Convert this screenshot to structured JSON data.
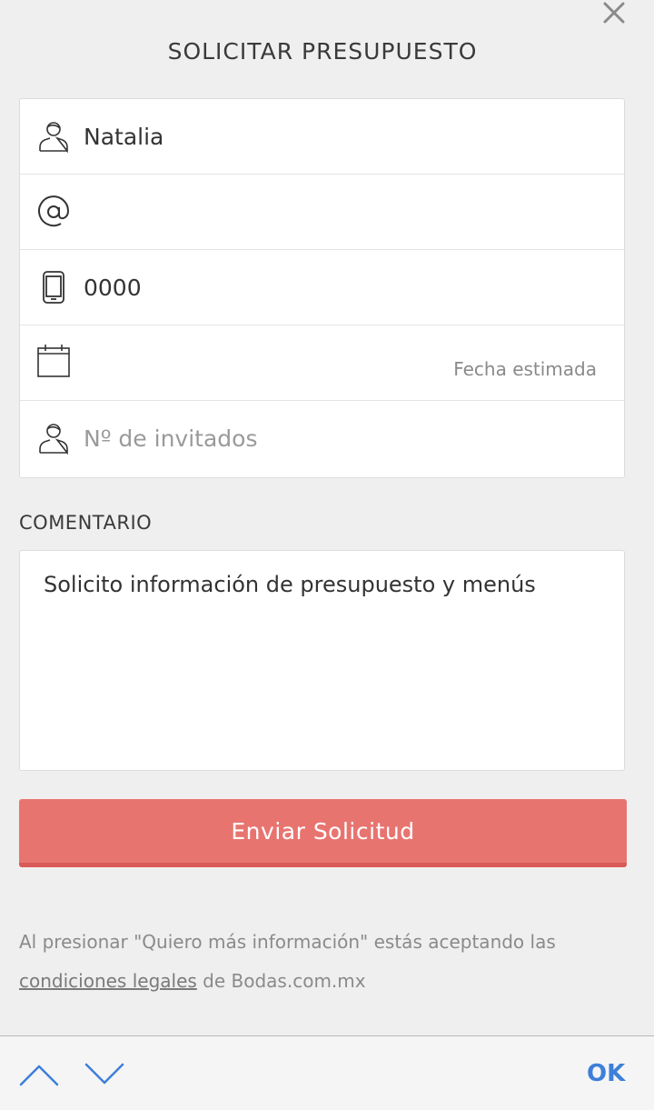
{
  "dialog": {
    "title": "SOLICITAR PRESUPUESTO",
    "close_icon": "close-icon"
  },
  "form": {
    "name": {
      "icon": "person-icon",
      "value": "Natalia",
      "placeholder": ""
    },
    "email": {
      "icon": "at-sign-icon",
      "value": "",
      "placeholder": ""
    },
    "phone": {
      "icon": "mobile-phone-icon",
      "value": "0000",
      "placeholder": ""
    },
    "date": {
      "icon": "calendar-icon",
      "placeholder": "Fecha estimada"
    },
    "guests": {
      "icon": "person-icon",
      "value": "",
      "placeholder": "Nº de invitados"
    }
  },
  "comment": {
    "label": "COMENTARIO",
    "value": "Solicito información de presupuesto y menús"
  },
  "submit": {
    "label": "Enviar Solicitud"
  },
  "legal": {
    "prefix": "Al presionar \"Quiero más información\" estás aceptando las",
    "link_text": "condiciones legales",
    "suffix": " de Bodas.com.mx"
  },
  "keyboard_toolbar": {
    "prev_icon": "chevron-up-icon",
    "next_icon": "chevron-down-icon",
    "ok_label": "OK"
  },
  "colors": {
    "accent": "#e87470",
    "link_blue": "#3d7fd9",
    "background": "#efefef"
  }
}
